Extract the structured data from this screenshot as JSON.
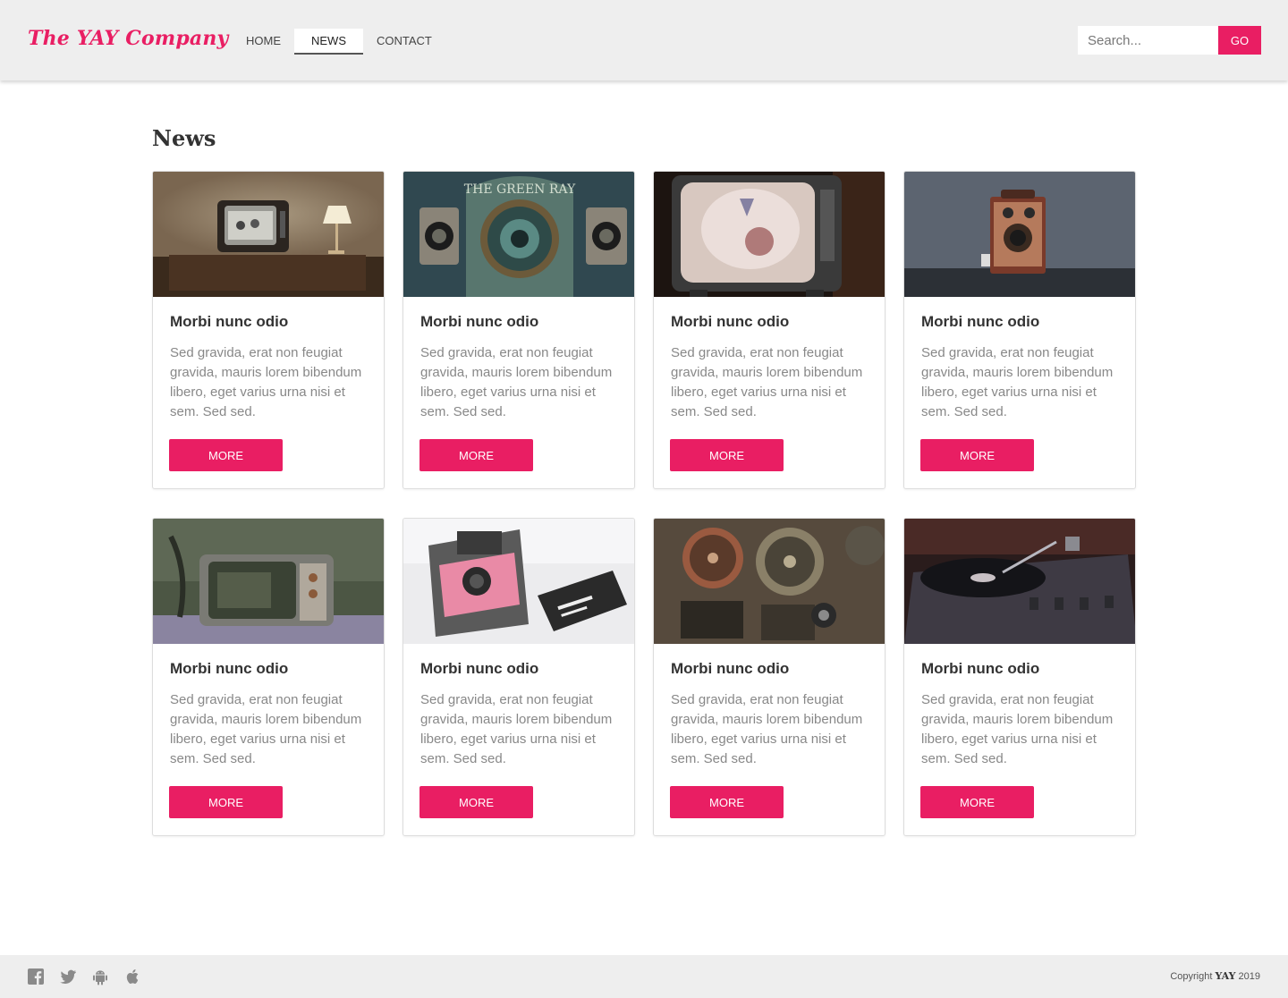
{
  "header": {
    "logo": "The YAY Company",
    "nav": [
      {
        "label": "HOME"
      },
      {
        "label": "NEWS"
      },
      {
        "label": "CONTACT"
      }
    ],
    "active_nav": "NEWS",
    "search": {
      "placeholder": "Search...",
      "value": "",
      "button_label": "GO"
    }
  },
  "main": {
    "title": "News",
    "cards": [
      {
        "title": "Morbi nunc odio",
        "text": "Sed gravida, erat non feugiat gravida, mauris lorem bibendum libero, eget varius urna nisi et sem. Sed sed.",
        "button": "MORE",
        "image": "vintage-tv-with-lamp"
      },
      {
        "title": "Morbi nunc odio",
        "text": "Sed gravida, erat non feugiat gravida, mauris lorem bibendum libero, eget varius urna nisi et sem. Sed sed.",
        "button": "MORE",
        "image": "green-ray-speaker-machine"
      },
      {
        "title": "Morbi nunc odio",
        "text": "Sed gravida, erat non feugiat gravida, mauris lorem bibendum libero, eget varius urna nisi et sem. Sed sed.",
        "button": "MORE",
        "image": "retro-tv-screen"
      },
      {
        "title": "Morbi nunc odio",
        "text": "Sed gravida, erat non feugiat gravida, mauris lorem bibendum libero, eget varius urna nisi et sem. Sed sed.",
        "button": "MORE",
        "image": "brownie-box-camera"
      },
      {
        "title": "Morbi nunc odio",
        "text": "Sed gravida, erat non feugiat gravida, mauris lorem bibendum libero, eget varius urna nisi et sem. Sed sed.",
        "button": "MORE",
        "image": "abandoned-tv-set"
      },
      {
        "title": "Morbi nunc odio",
        "text": "Sed gravida, erat non feugiat gravida, mauris lorem bibendum libero, eget varius urna nisi et sem. Sed sed.",
        "button": "MORE",
        "image": "pink-polaroid-camera"
      },
      {
        "title": "Morbi nunc odio",
        "text": "Sed gravida, erat non feugiat gravida, mauris lorem bibendum libero, eget varius urna nisi et sem. Sed sed.",
        "button": "MORE",
        "image": "film-projector-reels"
      },
      {
        "title": "Morbi nunc odio",
        "text": "Sed gravida, erat non feugiat gravida, mauris lorem bibendum libero, eget varius urna nisi et sem. Sed sed.",
        "button": "MORE",
        "image": "vinyl-turntable"
      }
    ]
  },
  "footer": {
    "social_icons": [
      "facebook-icon",
      "twitter-icon",
      "android-icon",
      "apple-icon"
    ],
    "copyright_prefix": "Copyright",
    "copyright_brand": "YAY",
    "copyright_year": "2019"
  },
  "colors": {
    "accent": "#e91e63",
    "header_bg": "#eeeeee",
    "footer_bg": "#eeeeee",
    "text_muted": "#888888"
  }
}
